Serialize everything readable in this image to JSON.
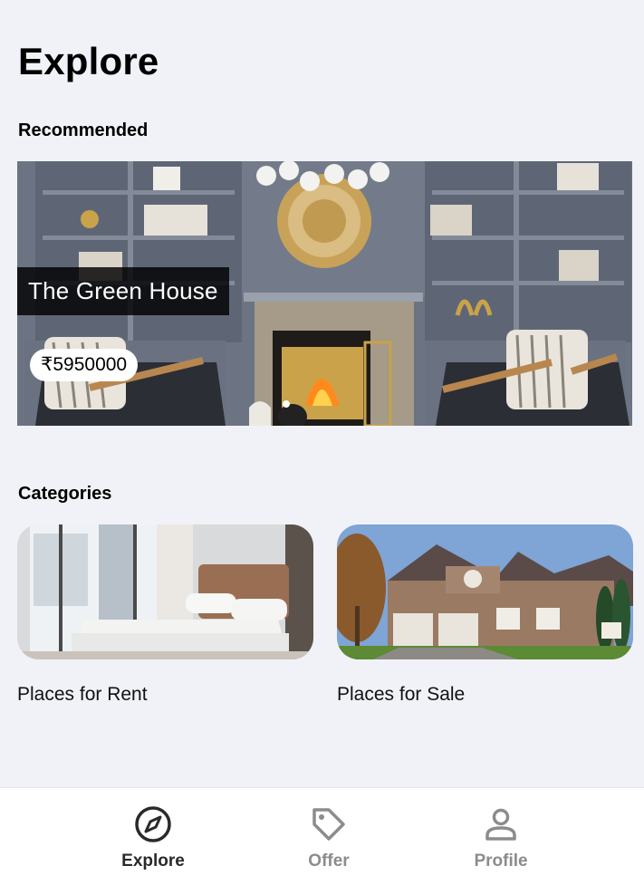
{
  "header": {
    "title": "Explore"
  },
  "recommended": {
    "section_title": "Recommended",
    "card": {
      "title": "The Green House",
      "price": "₹5950000"
    }
  },
  "categories": {
    "section_title": "Categories",
    "items": [
      {
        "label": "Places for Rent"
      },
      {
        "label": "Places for Sale"
      }
    ]
  },
  "nav": {
    "items": [
      {
        "label": "Explore",
        "icon": "compass-icon",
        "active": true
      },
      {
        "label": "Offer",
        "icon": "tag-icon",
        "active": false
      },
      {
        "label": "Profile",
        "icon": "person-icon",
        "active": false
      }
    ]
  },
  "colors": {
    "background": "#f1f2f7",
    "active_nav": "#2a2a2a",
    "inactive_nav": "#8c8c8c"
  }
}
